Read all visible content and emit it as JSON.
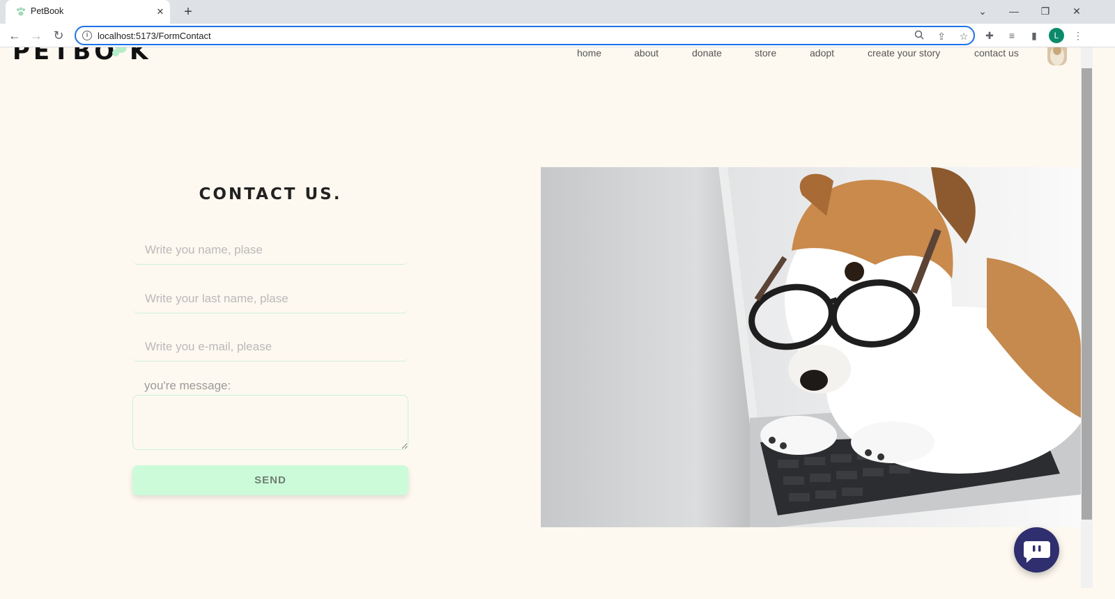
{
  "browser": {
    "tab_title": "PetBook",
    "url": "localhost:5173/FormContact",
    "profile_initial": "L",
    "icons": [
      "paw-favicon-icon",
      "close-icon",
      "plus-icon",
      "chevron-down-icon",
      "minimize-icon",
      "restore-icon",
      "window-close-icon",
      "back-arrow-icon",
      "forward-arrow-icon",
      "reload-icon",
      "info-icon",
      "zoom-icon",
      "share-icon",
      "star-icon",
      "extensions-icon",
      "media-icon",
      "side-panel-icon",
      "kebab-menu-icon"
    ]
  },
  "site": {
    "logo_text": "PETBO  K",
    "nav": [
      "home",
      "about",
      "donate",
      "store",
      "adopt",
      "create your story",
      "contact us"
    ]
  },
  "form": {
    "title": "CONTACT US.",
    "name_placeholder": "Write you name, plase",
    "lastname_placeholder": "Write your last name, plase",
    "email_placeholder": "Write you e-mail, please",
    "message_label": "you're message:",
    "send_label": "SEND"
  },
  "colors": {
    "page_bg": "#fef9f0",
    "accent_green": "#ccfbd9",
    "chat_button": "#2f2e6f",
    "omnibox_focus": "#1a73e8"
  }
}
